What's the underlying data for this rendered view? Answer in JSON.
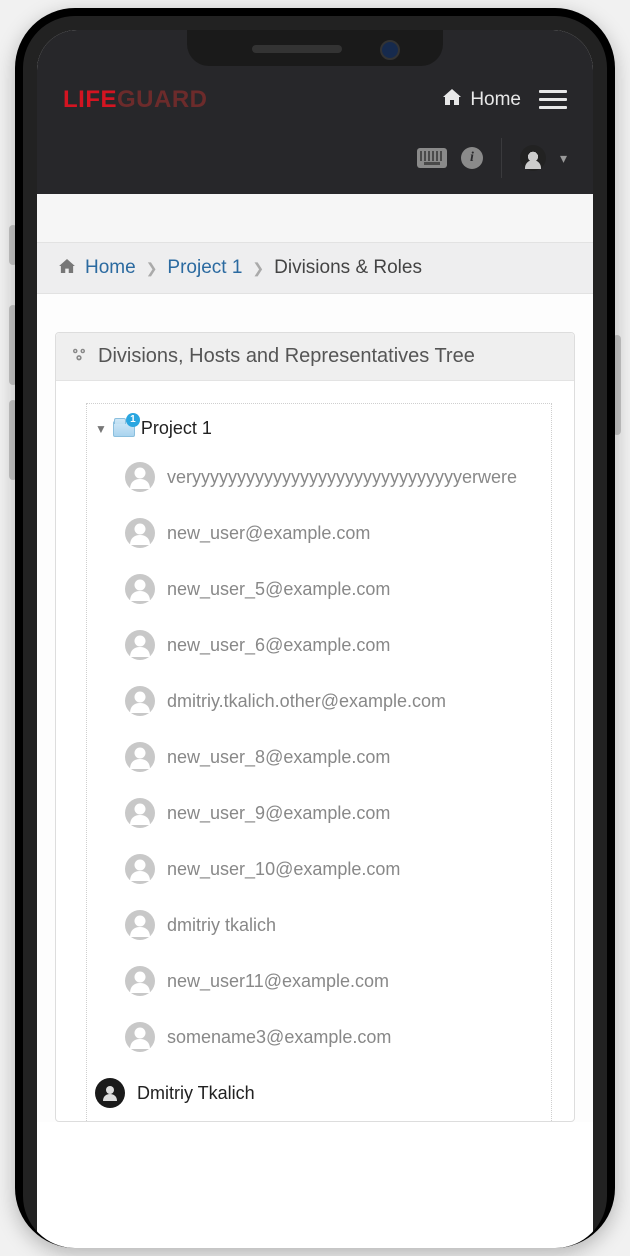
{
  "brand": {
    "part1": "LIFE",
    "part2": "GUARD"
  },
  "header": {
    "home_label": "Home",
    "icons": {
      "keyboard": "keyboard",
      "info": "i"
    }
  },
  "breadcrumbs": {
    "home": "Home",
    "project": "Project 1",
    "leaf": "Divisions & Roles"
  },
  "panel": {
    "title": "Divisions, Hosts and Representatives Tree"
  },
  "tree": {
    "root_label": "Project 1",
    "root_badge": "1",
    "items": [
      {
        "label": "veryyyyyyyyyyyyyyyyyyyyyyyyyyyyyyerwere",
        "active": false
      },
      {
        "label": "new_user@example.com",
        "active": false
      },
      {
        "label": "new_user_5@example.com",
        "active": false
      },
      {
        "label": "new_user_6@example.com",
        "active": false
      },
      {
        "label": "dmitriy.tkalich.other@example.com",
        "active": false
      },
      {
        "label": "new_user_8@example.com",
        "active": false
      },
      {
        "label": "new_user_9@example.com",
        "active": false
      },
      {
        "label": "new_user_10@example.com",
        "active": false
      },
      {
        "label": "dmitriy tkalich",
        "active": false
      },
      {
        "label": "new_user11@example.com",
        "active": false
      },
      {
        "label": "somename3@example.com",
        "active": false
      },
      {
        "label": "Dmitriy Tkalich",
        "active": true
      }
    ]
  }
}
